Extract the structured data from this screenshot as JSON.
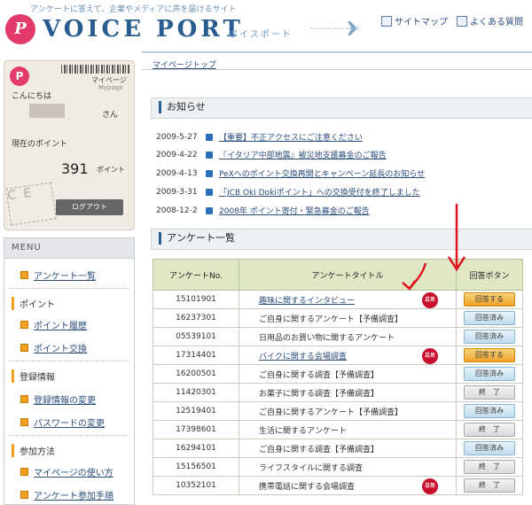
{
  "header": {
    "tagline": "アンケートに答えて、企業やメディアに声を届けるサイト",
    "logo_mark": "P",
    "logo_text": "VOICE PORT",
    "logo_kana": "ボイスポート",
    "links": [
      "サイトマップ",
      "よくある質問"
    ]
  },
  "user_card": {
    "mypage": "マイページ",
    "mypage_en": "Mypage",
    "greeting": "こんにちは",
    "honorific": "さん",
    "points_label": "現在のポイント",
    "points_value": "391",
    "points_unit": "ポイント",
    "stamp_text": "C E",
    "logout_label": "ログアウト"
  },
  "menu": {
    "title": "MENU",
    "item_survey_list": "アンケート一覧",
    "sec_points": "ポイント",
    "item_point_history": "ポイント履歴",
    "item_point_exchange": "ポイント交換",
    "sec_registration": "登録情報",
    "item_change_info": "登録情報の変更",
    "item_change_password": "パスワードの変更",
    "sec_how_to": "参加方法",
    "item_how_to_mypage": "マイページの使い方",
    "item_how_to_survey": "アンケート参加手順"
  },
  "breadcrumb": "マイページトップ",
  "news": {
    "heading": "お知らせ",
    "items": [
      {
        "date": "2009-5-27",
        "text": "【重要】不正アクセスにご注意ください"
      },
      {
        "date": "2009-4-22",
        "text": "『イタリア中部地震』被災地支援募金のご報告"
      },
      {
        "date": "2009-4-13",
        "text": "PeXへのポイント交換再開とキャンペーン延長のお知らせ"
      },
      {
        "date": "2009-3-31",
        "text": "「JCB Oki Dokiポイント」への交換受付を終了しました"
      },
      {
        "date": "2008-12-2",
        "text": "2008年 ポイント寄付・緊急募金のご報告"
      }
    ]
  },
  "surveys": {
    "heading": "アンケート一覧",
    "col_no": "アンケートNo.",
    "col_title": "アンケートタイトル",
    "col_button": "回答ボタン",
    "badge_text": "募集",
    "rows": [
      {
        "no": "15101901",
        "title": "趣味に関するインタビュー",
        "status": "回答する",
        "kind": "ans"
      },
      {
        "no": "16237301",
        "title": "ご自身に関するアンケート【予備調査】",
        "status": "回答済み",
        "kind": "done"
      },
      {
        "no": "05539101",
        "title": "日用品のお買い物に関するアンケート",
        "status": "回答済み",
        "kind": "done"
      },
      {
        "no": "17314401",
        "title": "バイクに関する会場調査",
        "status": "回答する",
        "kind": "ans"
      },
      {
        "no": "16200501",
        "title": "ご自身に関する調査【予備調査】",
        "status": "回答済み",
        "kind": "done"
      },
      {
        "no": "11420301",
        "title": "お菓子に関する調査【予備調査】",
        "status": "終　了",
        "kind": "end"
      },
      {
        "no": "12519401",
        "title": "ご自身に関するアンケート【予備調査】",
        "status": "回答済み",
        "kind": "done"
      },
      {
        "no": "17398601",
        "title": "生活に関するアンケート",
        "status": "終　了",
        "kind": "end"
      },
      {
        "no": "16294101",
        "title": "ご自身に関する調査【予備調査】",
        "status": "回答済み",
        "kind": "done"
      },
      {
        "no": "15156501",
        "title": "ライフスタイルに関する調査",
        "status": "終　了",
        "kind": "end"
      },
      {
        "no": "10352101",
        "title": "携帯電話に関する会場調査",
        "status": "終　了",
        "kind": "end"
      }
    ]
  },
  "colors": {
    "accent": "#2a5d8f",
    "brand": "#e23b6a",
    "annotation": "#e0141e"
  }
}
